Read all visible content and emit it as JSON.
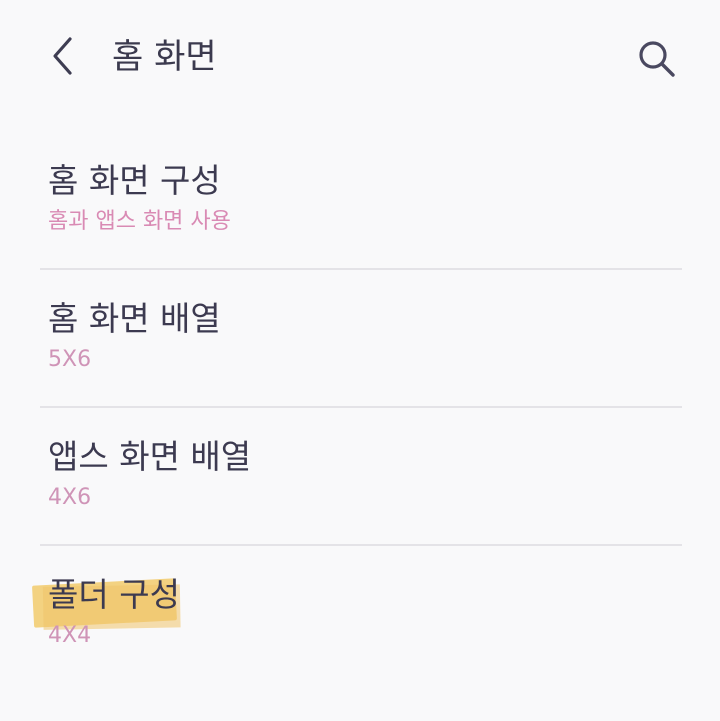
{
  "header": {
    "title": "홈 화면",
    "back_icon": "back-chevron-icon",
    "search_icon": "search-icon"
  },
  "settings": [
    {
      "title": "홈 화면 구성",
      "subtitle": "홈과 앱스 화면 사용"
    },
    {
      "title": "홈 화면 배열",
      "subtitle": "5X6"
    },
    {
      "title": "앱스 화면 배열",
      "subtitle": "4X6"
    },
    {
      "title": "폴더 구성",
      "subtitle": "4X4"
    }
  ],
  "colors": {
    "background": "#f9f9fa",
    "title_text": "#3c3a50",
    "subtitle_text": "#d98ab4",
    "divider": "#e4e3e7",
    "highlight": "#f3cd71"
  }
}
